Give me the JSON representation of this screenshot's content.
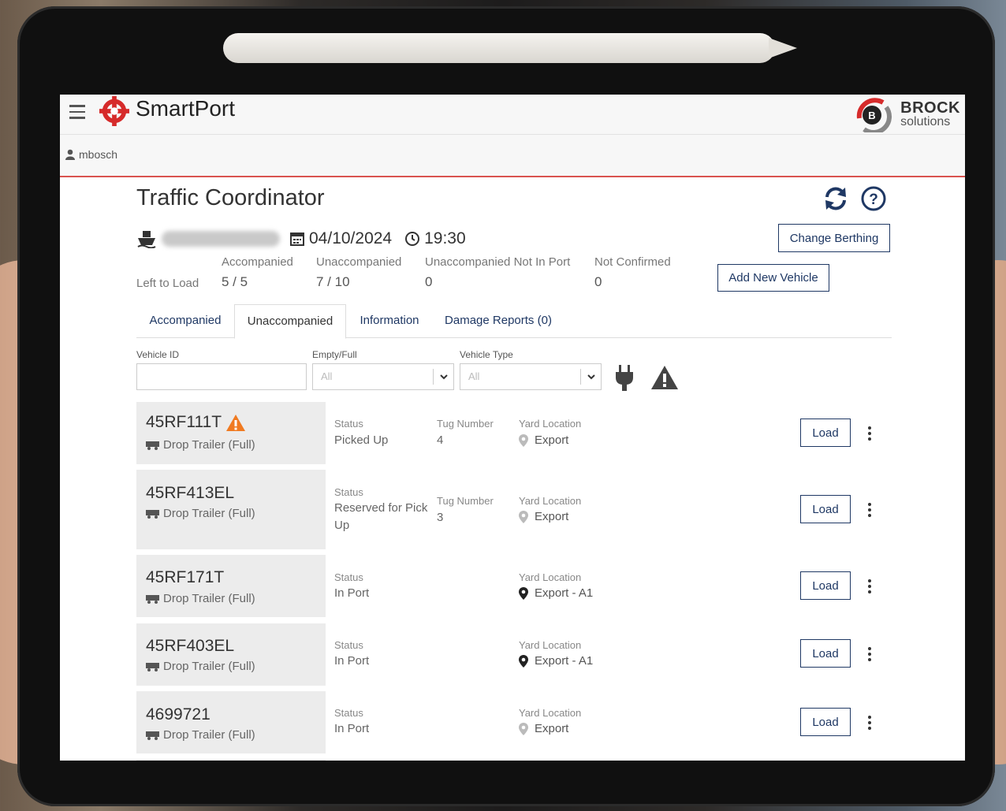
{
  "app": {
    "name": "SmartPort",
    "brand_line1": "BROCK",
    "brand_line2": "solutions",
    "brand_badge": "B"
  },
  "user": {
    "name": "mbosch"
  },
  "page": {
    "title": "Traffic Coordinator"
  },
  "voyage": {
    "date": "04/10/2024",
    "time": "19:30"
  },
  "actions": {
    "change_berthing": "Change Berthing",
    "add_vehicle": "Add New Vehicle"
  },
  "stats": {
    "left_to_load_label": "Left to Load",
    "accompanied": {
      "label": "Accompanied",
      "value": "5 / 5"
    },
    "unaccompanied": {
      "label": "Unaccompanied",
      "value": "7 / 10"
    },
    "not_in_port": {
      "label": "Unaccompanied Not In Port",
      "value": "0"
    },
    "not_confirmed": {
      "label": "Not Confirmed",
      "value": "0"
    }
  },
  "tabs": [
    {
      "label": "Accompanied"
    },
    {
      "label": "Unaccompanied"
    },
    {
      "label": "Information"
    },
    {
      "label": "Damage Reports (0)"
    }
  ],
  "filters": {
    "vehicle_id_label": "Vehicle ID",
    "empty_full_label": "Empty/Full",
    "empty_full_value": "All",
    "vehicle_type_label": "Vehicle Type",
    "vehicle_type_value": "All"
  },
  "labels": {
    "status": "Status",
    "tug": "Tug Number",
    "yard": "Yard Location",
    "load": "Load"
  },
  "vehicles": [
    {
      "id": "45RF111T",
      "type": "Drop Trailer (Full)",
      "warning": true,
      "status": "Picked Up",
      "tug": "4",
      "yard": "Export",
      "yard_confirmed": false
    },
    {
      "id": "45RF413EL",
      "type": "Drop Trailer (Full)",
      "status_line1": "Reserved for Pick",
      "status_line2": "Up",
      "tug": "3",
      "yard": "Export",
      "yard_confirmed": false
    },
    {
      "id": "45RF171T",
      "type": "Drop Trailer (Full)",
      "status": "In Port",
      "yard": "Export - A1",
      "yard_confirmed": true
    },
    {
      "id": "45RF403EL",
      "type": "Drop Trailer (Full)",
      "status": "In Port",
      "yard": "Export - A1",
      "yard_confirmed": true
    },
    {
      "id": "4699721",
      "type": "Drop Trailer (Full)",
      "status": "In Port",
      "yard": "Export",
      "yard_confirmed": false
    }
  ],
  "colors": {
    "accent_red": "#d9534f",
    "link_blue": "#1f3864",
    "warning_orange": "#f07a21"
  }
}
